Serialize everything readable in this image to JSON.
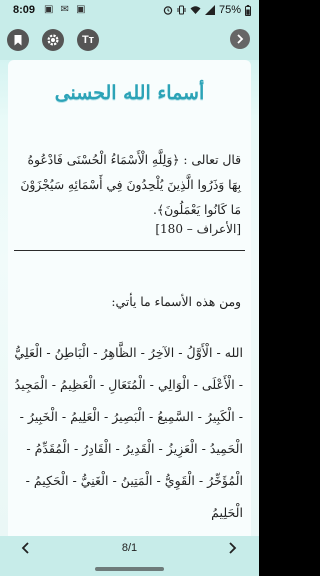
{
  "status": {
    "time": "8:09",
    "notifications": "▣ ✉ ▣",
    "battery": "75%"
  },
  "toolbar": {
    "font_button": "Tт"
  },
  "page": {
    "title": "أسماء الله الحسنى",
    "quran_text": "قال تعالى : ﴿وَلِلَّهِ الْأَسْمَاءُ الْحُسْنَى فَادْعُوهُ بِهَا وَذَرُوا الَّذِينَ يُلْحِدُونَ فِي أَسْمَائِهِ سَيُجْزَوْنَ مَا كَانُوا يَعْمَلُونَ﴾.",
    "reference": "[الأعراف – 180]",
    "intro": "ومن هذه الأسماء ما يأتي:",
    "names_text": "الله - الْأَوَّلُ - الآخِرُ - الظَّاهِرُ - الْبَاطِنُ - الْعَلِيُّ - الْأَعْلَى - الْوَالِي - الْمُتَعَالِ - الْعَظِيمُ - الْمَجِيدُ - الْكَبِيرُ - السَّمِيعُ - الْبَصِيرُ - الْعَلِيمُ - الْخَبِيرُ - الْحَمِيدُ - الْعَزِيزُ - الْقَدِيرُ - الْقَادِرُ - الْمُقَدِّمُ - الْمُؤَخِّرُ - الْقَوِيُّ - الْمَتِينُ - الْغَنِيُّ - الْحَكِيمُ - الْحَلِيمُ"
  },
  "footer": {
    "page_indicator": "8/1"
  }
}
